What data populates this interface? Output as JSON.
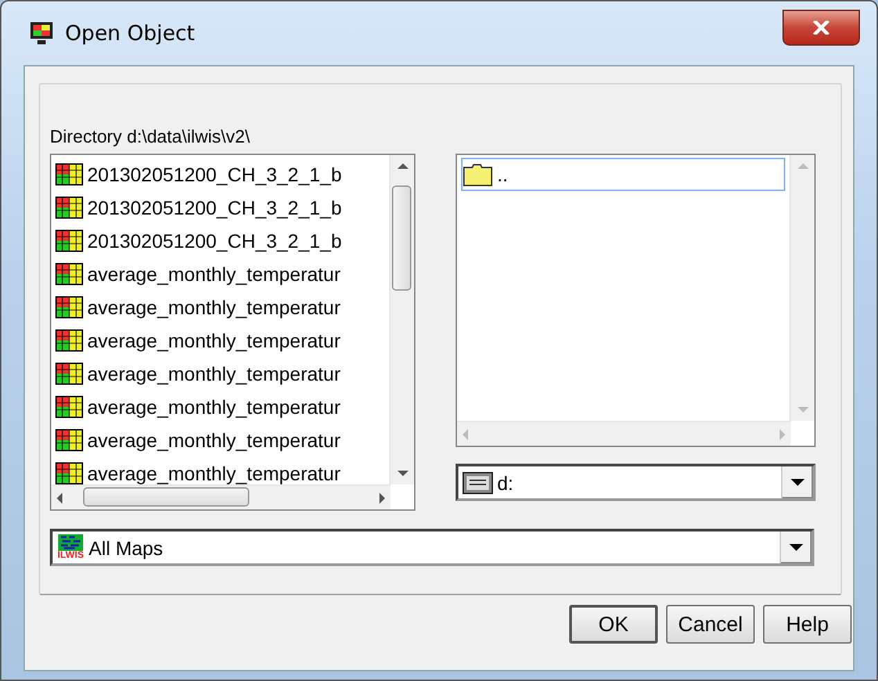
{
  "window": {
    "title": "Open Object"
  },
  "directory_label": "Directory d:\\data\\ilwis\\v2\\",
  "object_list": {
    "items": [
      {
        "name": "201302051200_CH_3_2_1_b",
        "selected": false
      },
      {
        "name": "201302051200_CH_3_2_1_b",
        "selected": false
      },
      {
        "name": "201302051200_CH_3_2_1_b",
        "selected": false
      },
      {
        "name": "average_monthly_temperatur",
        "selected": false
      },
      {
        "name": "average_monthly_temperatur",
        "selected": false
      },
      {
        "name": "average_monthly_temperatur",
        "selected": false
      },
      {
        "name": "average_monthly_temperatur",
        "selected": false
      },
      {
        "name": "average_monthly_temperatur",
        "selected": false
      },
      {
        "name": "average_monthly_temperatur",
        "selected": false
      },
      {
        "name": "average_monthly_temperatur",
        "selected": false
      }
    ]
  },
  "folder_list": {
    "items": [
      {
        "name": "..",
        "selected": true
      }
    ]
  },
  "drive": {
    "value": "d:"
  },
  "filter": {
    "value": "All Maps",
    "logo_text": "ILWIS"
  },
  "buttons": [
    "OK",
    "Cancel",
    "Help"
  ]
}
